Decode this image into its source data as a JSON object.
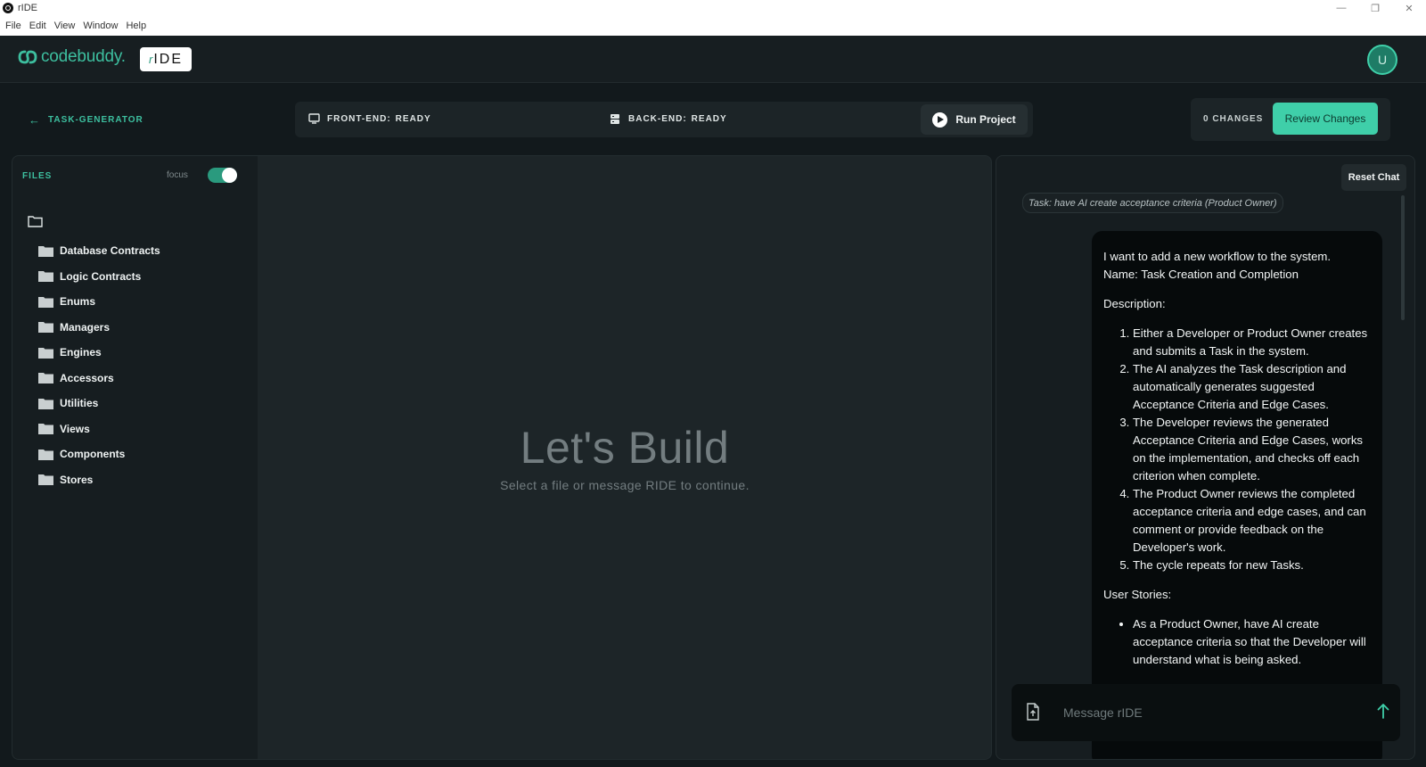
{
  "window": {
    "title": "rIDE"
  },
  "menu": [
    "File",
    "Edit",
    "View",
    "Window",
    "Help"
  ],
  "header": {
    "logo_text": "codebuddy.",
    "badge_r": "r",
    "badge_text": "IDE",
    "avatar_letter": "U"
  },
  "toolbar": {
    "back_label": "TASK-GENERATOR",
    "frontend_label": "FRONT-END:",
    "frontend_status": "READY",
    "backend_label": "BACK-END:",
    "backend_status": "READY",
    "run_label": "Run Project",
    "changes_label": "0 CHANGES",
    "review_label": "Review Changes"
  },
  "files": {
    "title": "FILES",
    "focus_label": "focus",
    "items": [
      "Database Contracts",
      "Logic Contracts",
      "Enums",
      "Managers",
      "Engines",
      "Accessors",
      "Utilities",
      "Views",
      "Components",
      "Stores"
    ]
  },
  "editor": {
    "title": "Let's Build",
    "subtitle": "Select a file or message RIDE to continue."
  },
  "chat": {
    "reset_label": "Reset Chat",
    "task_chip": "Task: have AI create acceptance criteria (Product Owner)",
    "message": {
      "intro": [
        "I want to add a new workflow to the system.",
        "Name: Task Creation and Completion"
      ],
      "description_heading": "Description:",
      "steps": [
        "Either a Developer or Product Owner creates and submits a Task in the system.",
        "The AI analyzes the Task description and automatically generates suggested Acceptance Criteria and Edge Cases.",
        "The Developer reviews the generated Acceptance Criteria and Edge Cases, works on the implementation, and checks off each criterion when complete.",
        "The Product Owner reviews the completed acceptance criteria and edge cases, and can comment or provide feedback on the Developer's work.",
        "The cycle repeats for new Tasks."
      ],
      "stories_heading": "User Stories:",
      "stories": [
        "As a Product Owner, have AI create acceptance criteria so that the Developer will understand what is being asked."
      ]
    },
    "input_placeholder": "Message rIDE"
  },
  "colors": {
    "accent": "#3fcfa9",
    "accent_text": "#3dbf9f",
    "background": "#12191c",
    "panel": "#161d20",
    "editor": "#1d2528"
  }
}
